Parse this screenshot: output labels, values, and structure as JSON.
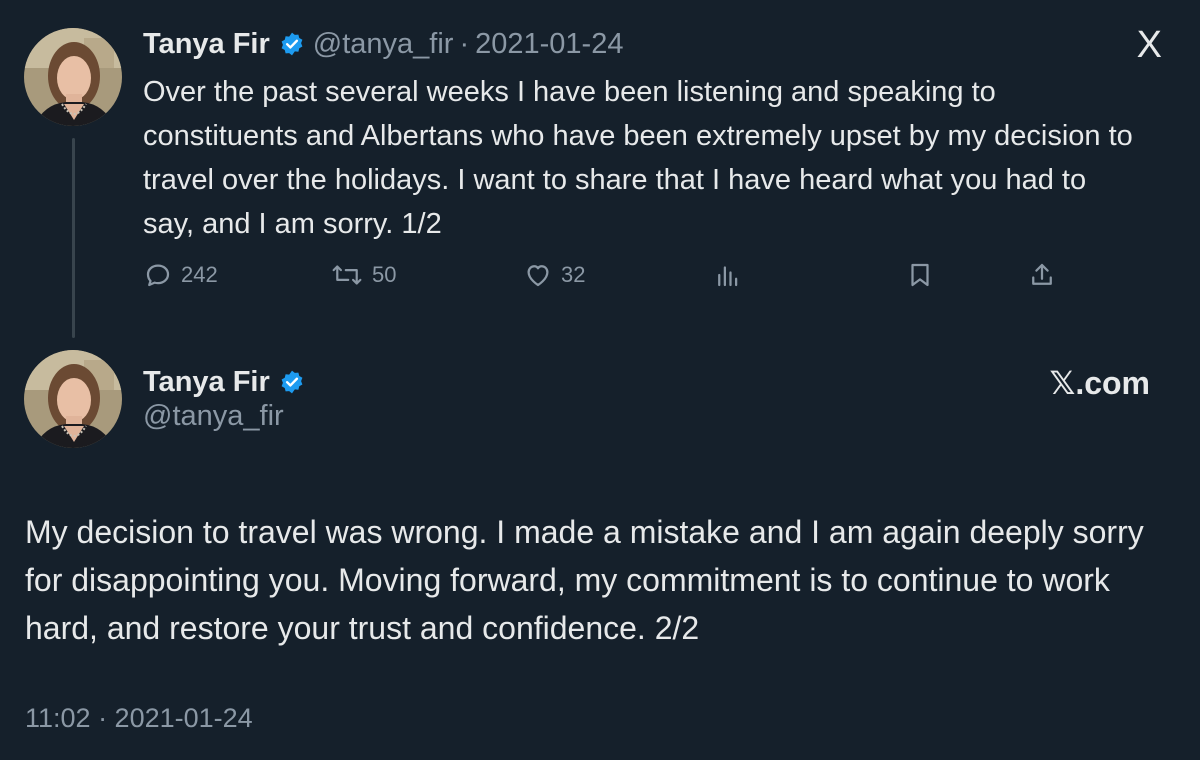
{
  "colors": {
    "background": "#15202b",
    "text": "#e7e9ea",
    "muted": "#8b98a5",
    "verified": "#1d9bf0",
    "thread_line": "#38444d"
  },
  "tweet1": {
    "author_name": "Tanya Fir",
    "handle": "@tanya_fir",
    "separator": "·",
    "date": "2021-01-24",
    "platform_icon": "X",
    "text": "Over the past several weeks I have been listening and speaking to constituents and Albertans who have been extremely upset by my decision to travel over the holidays. I want to share that I have heard what you had to say, and I am sorry. 1/2",
    "actions": {
      "replies": "242",
      "retweets": "50",
      "likes": "32"
    },
    "icons": [
      "reply-icon",
      "retweet-icon",
      "like-icon",
      "views-icon",
      "bookmark-icon",
      "share-icon"
    ]
  },
  "tweet2": {
    "author_name": "Tanya Fir",
    "handle": "@tanya_fir",
    "platform_label": "𝕏.com",
    "text": "My decision to travel was wrong. I made a mistake and I am again deeply sorry for disappointing you. Moving forward, my commitment is to continue to work hard, and restore your trust and confidence. 2/2",
    "timestamp": "11:02 · 2021-01-24"
  }
}
